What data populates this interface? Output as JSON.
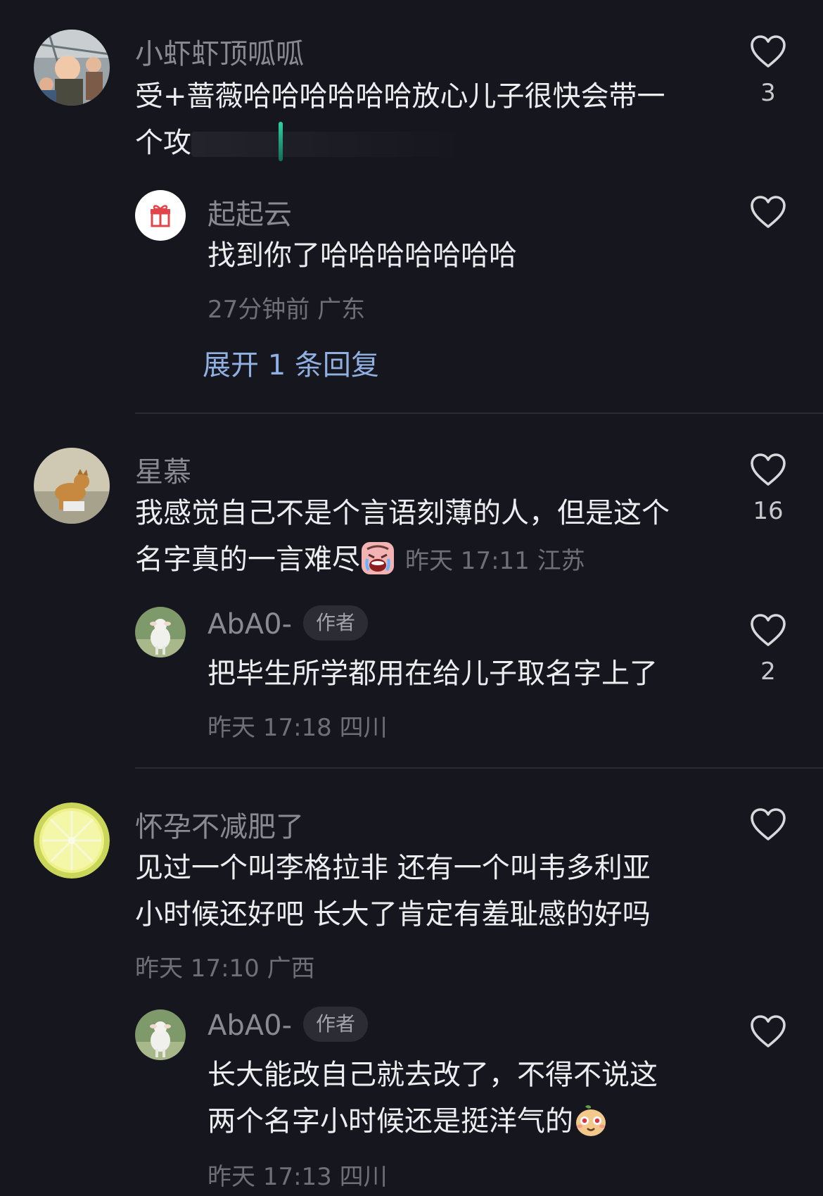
{
  "comments": [
    {
      "username": "小虾虾顶呱呱",
      "text_line1": "受+蔷薇哈哈哈哈哈哈放心儿子很快会带一",
      "text_line2": "个攻",
      "likes": "3",
      "replies": [
        {
          "username": "起起云",
          "text": "找到你了哈哈哈哈哈哈哈",
          "meta": "27分钟前 广东"
        }
      ],
      "expand_label": "展开 1 条回复"
    },
    {
      "username": "星慕",
      "text_line1": "我感觉自己不是个言语刻薄的人，但是这个",
      "text_line2": "名字真的一言难尽",
      "meta": "昨天 17:11 江苏",
      "likes": "16",
      "replies": [
        {
          "username": "AbA0-",
          "badge": "作者",
          "text": "把毕生所学都用在给儿子取名字上了",
          "meta": "昨天 17:18 四川",
          "likes": "2"
        }
      ]
    },
    {
      "username": "怀孕不减肥了",
      "text_line1": "见过一个叫李格拉非 还有一个叫韦多利亚",
      "text_line2": "小时候还好吧 长大了肯定有羞耻感的好吗",
      "meta": "昨天 17:10 广西",
      "replies": [
        {
          "username": "AbA0-",
          "badge": "作者",
          "text_line1": "长大能改自己就去改了，不得不说这",
          "text_line2": "两个名字小时候还是挺洋气的",
          "meta": "昨天 17:13 四川"
        }
      ]
    }
  ],
  "icons": {
    "like": "heart-outline-icon",
    "gift_avatar": "gift-icon",
    "emoji_cry": "crying-face-emoji",
    "emoji_pear": "pear-face-emoji"
  },
  "colors": {
    "background": "#16161e",
    "username": "#8a8a94",
    "text": "#ededf0",
    "meta": "#6f6f78",
    "expand_link": "#8fb0e0"
  }
}
